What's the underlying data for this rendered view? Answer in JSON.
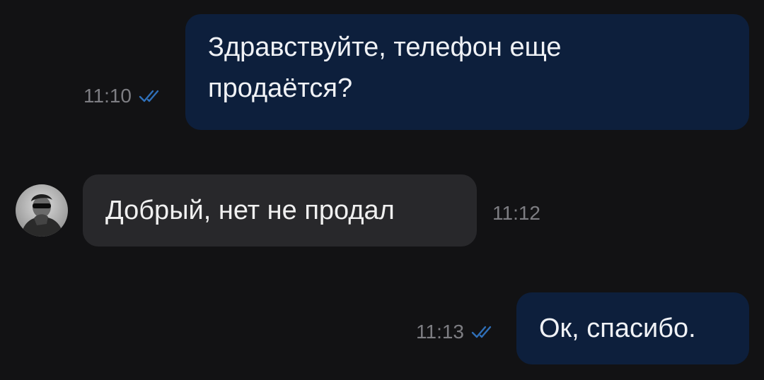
{
  "messages": [
    {
      "direction": "outgoing",
      "lines": [
        "Здравствуйте, телефон еще",
        "продаётся?"
      ],
      "time": "11:10",
      "status_icon": "double-check-icon",
      "status_color": "#2f6fb8"
    },
    {
      "direction": "incoming",
      "text": "Добрый, нет не продал",
      "time": "11:12",
      "avatar_icon": "user-avatar-photo"
    },
    {
      "direction": "outgoing",
      "text": "Ок, спасибо.",
      "time": "11:13",
      "status_icon": "double-check-icon",
      "status_color": "#2f6fb8"
    }
  ],
  "colors": {
    "background": "#121214",
    "outgoing_bubble": "#0d1f3c",
    "incoming_bubble": "#28282b",
    "timestamp": "#7d7d82"
  }
}
